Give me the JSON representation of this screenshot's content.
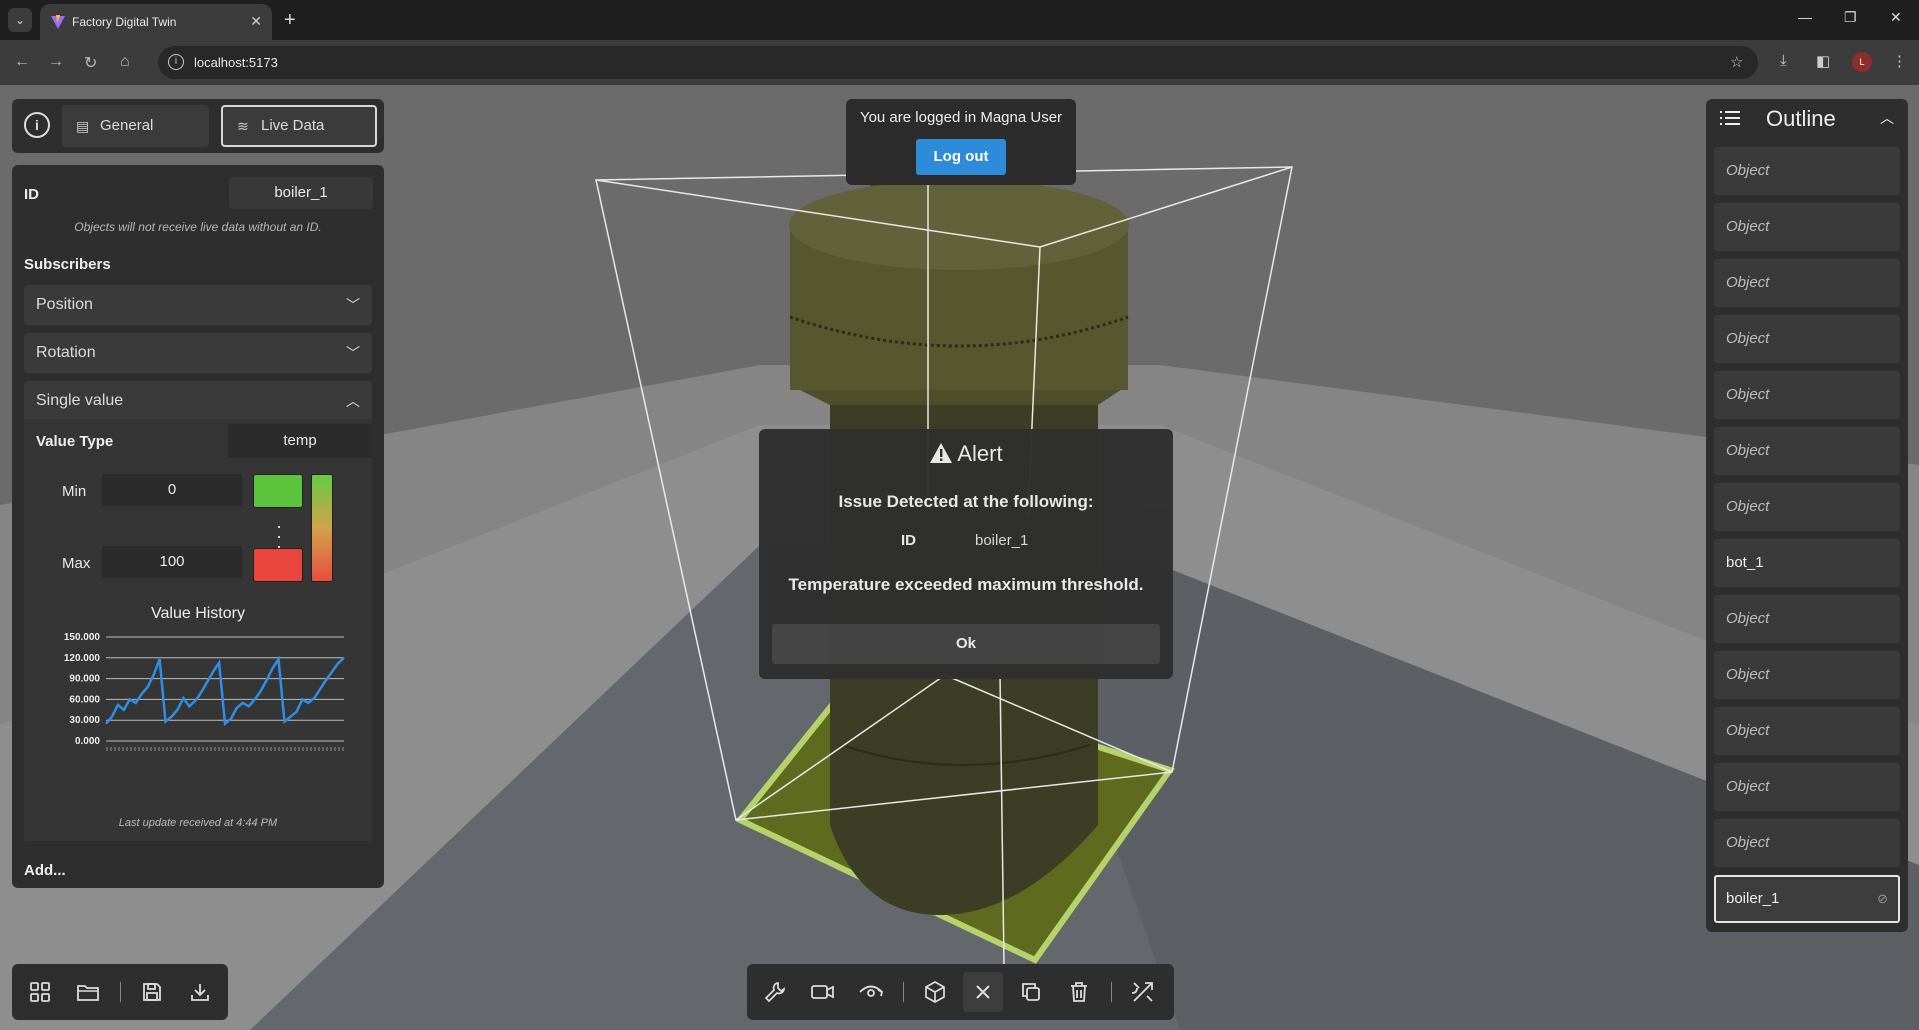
{
  "browser": {
    "tab_title": "Factory Digital Twin",
    "url": "localhost:5173",
    "profile_initial": "L"
  },
  "left_panel": {
    "tab_general": "General",
    "tab_live": "Live Data",
    "id_label": "ID",
    "id_value": "boiler_1",
    "id_note": "Objects will not receive live data without an ID.",
    "subscribers_label": "Subscribers",
    "accordions": [
      "Position",
      "Rotation",
      "Single value"
    ],
    "value_type_label": "Value Type",
    "value_type": "temp",
    "min_label": "Min",
    "min_value": "0",
    "max_label": "Max",
    "max_value": "100",
    "min_color": "#5cc43c",
    "max_color": "#e8463c",
    "history_title": "Value History",
    "last_update": "Last update received at 4:44 PM",
    "add_label": "Add..."
  },
  "chart_data": {
    "type": "line",
    "title": "Value History",
    "yticks": [
      "150.000",
      "120.000",
      "90.000",
      "60.000",
      "30.000",
      "0.000"
    ],
    "ylim": [
      0,
      150
    ],
    "x": [
      0,
      1,
      2,
      3,
      4,
      5,
      6,
      7,
      8,
      9,
      10,
      11,
      12,
      13,
      14,
      15,
      16,
      17,
      18,
      19,
      20,
      21,
      22,
      23,
      24,
      25,
      26,
      27,
      28,
      29,
      30,
      31,
      32,
      33,
      34,
      35,
      36,
      37,
      38,
      39,
      40
    ],
    "values": [
      25,
      35,
      52,
      45,
      60,
      55,
      68,
      78,
      95,
      118,
      28,
      35,
      45,
      62,
      50,
      58,
      70,
      85,
      100,
      113,
      25,
      32,
      48,
      55,
      50,
      60,
      72,
      88,
      105,
      118,
      28,
      35,
      42,
      60,
      55,
      62,
      75,
      88,
      100,
      112,
      120
    ],
    "color": "#2f8ee6",
    "grid": true
  },
  "login": {
    "message": "You are logged in Magna User",
    "logout_label": "Log out"
  },
  "alert": {
    "title": "Alert",
    "subtitle": "Issue Detected at the following:",
    "id_label": "ID",
    "id_value": "boiler_1",
    "message": "Temperature exceeded maximum threshold.",
    "ok_label": "Ok"
  },
  "outline": {
    "title": "Outline",
    "items": [
      "Object",
      "Object",
      "Object",
      "Object",
      "Object",
      "Object",
      "Object",
      "bot_1",
      "Object",
      "Object",
      "Object",
      "Object",
      "Object",
      "boiler_1"
    ]
  }
}
